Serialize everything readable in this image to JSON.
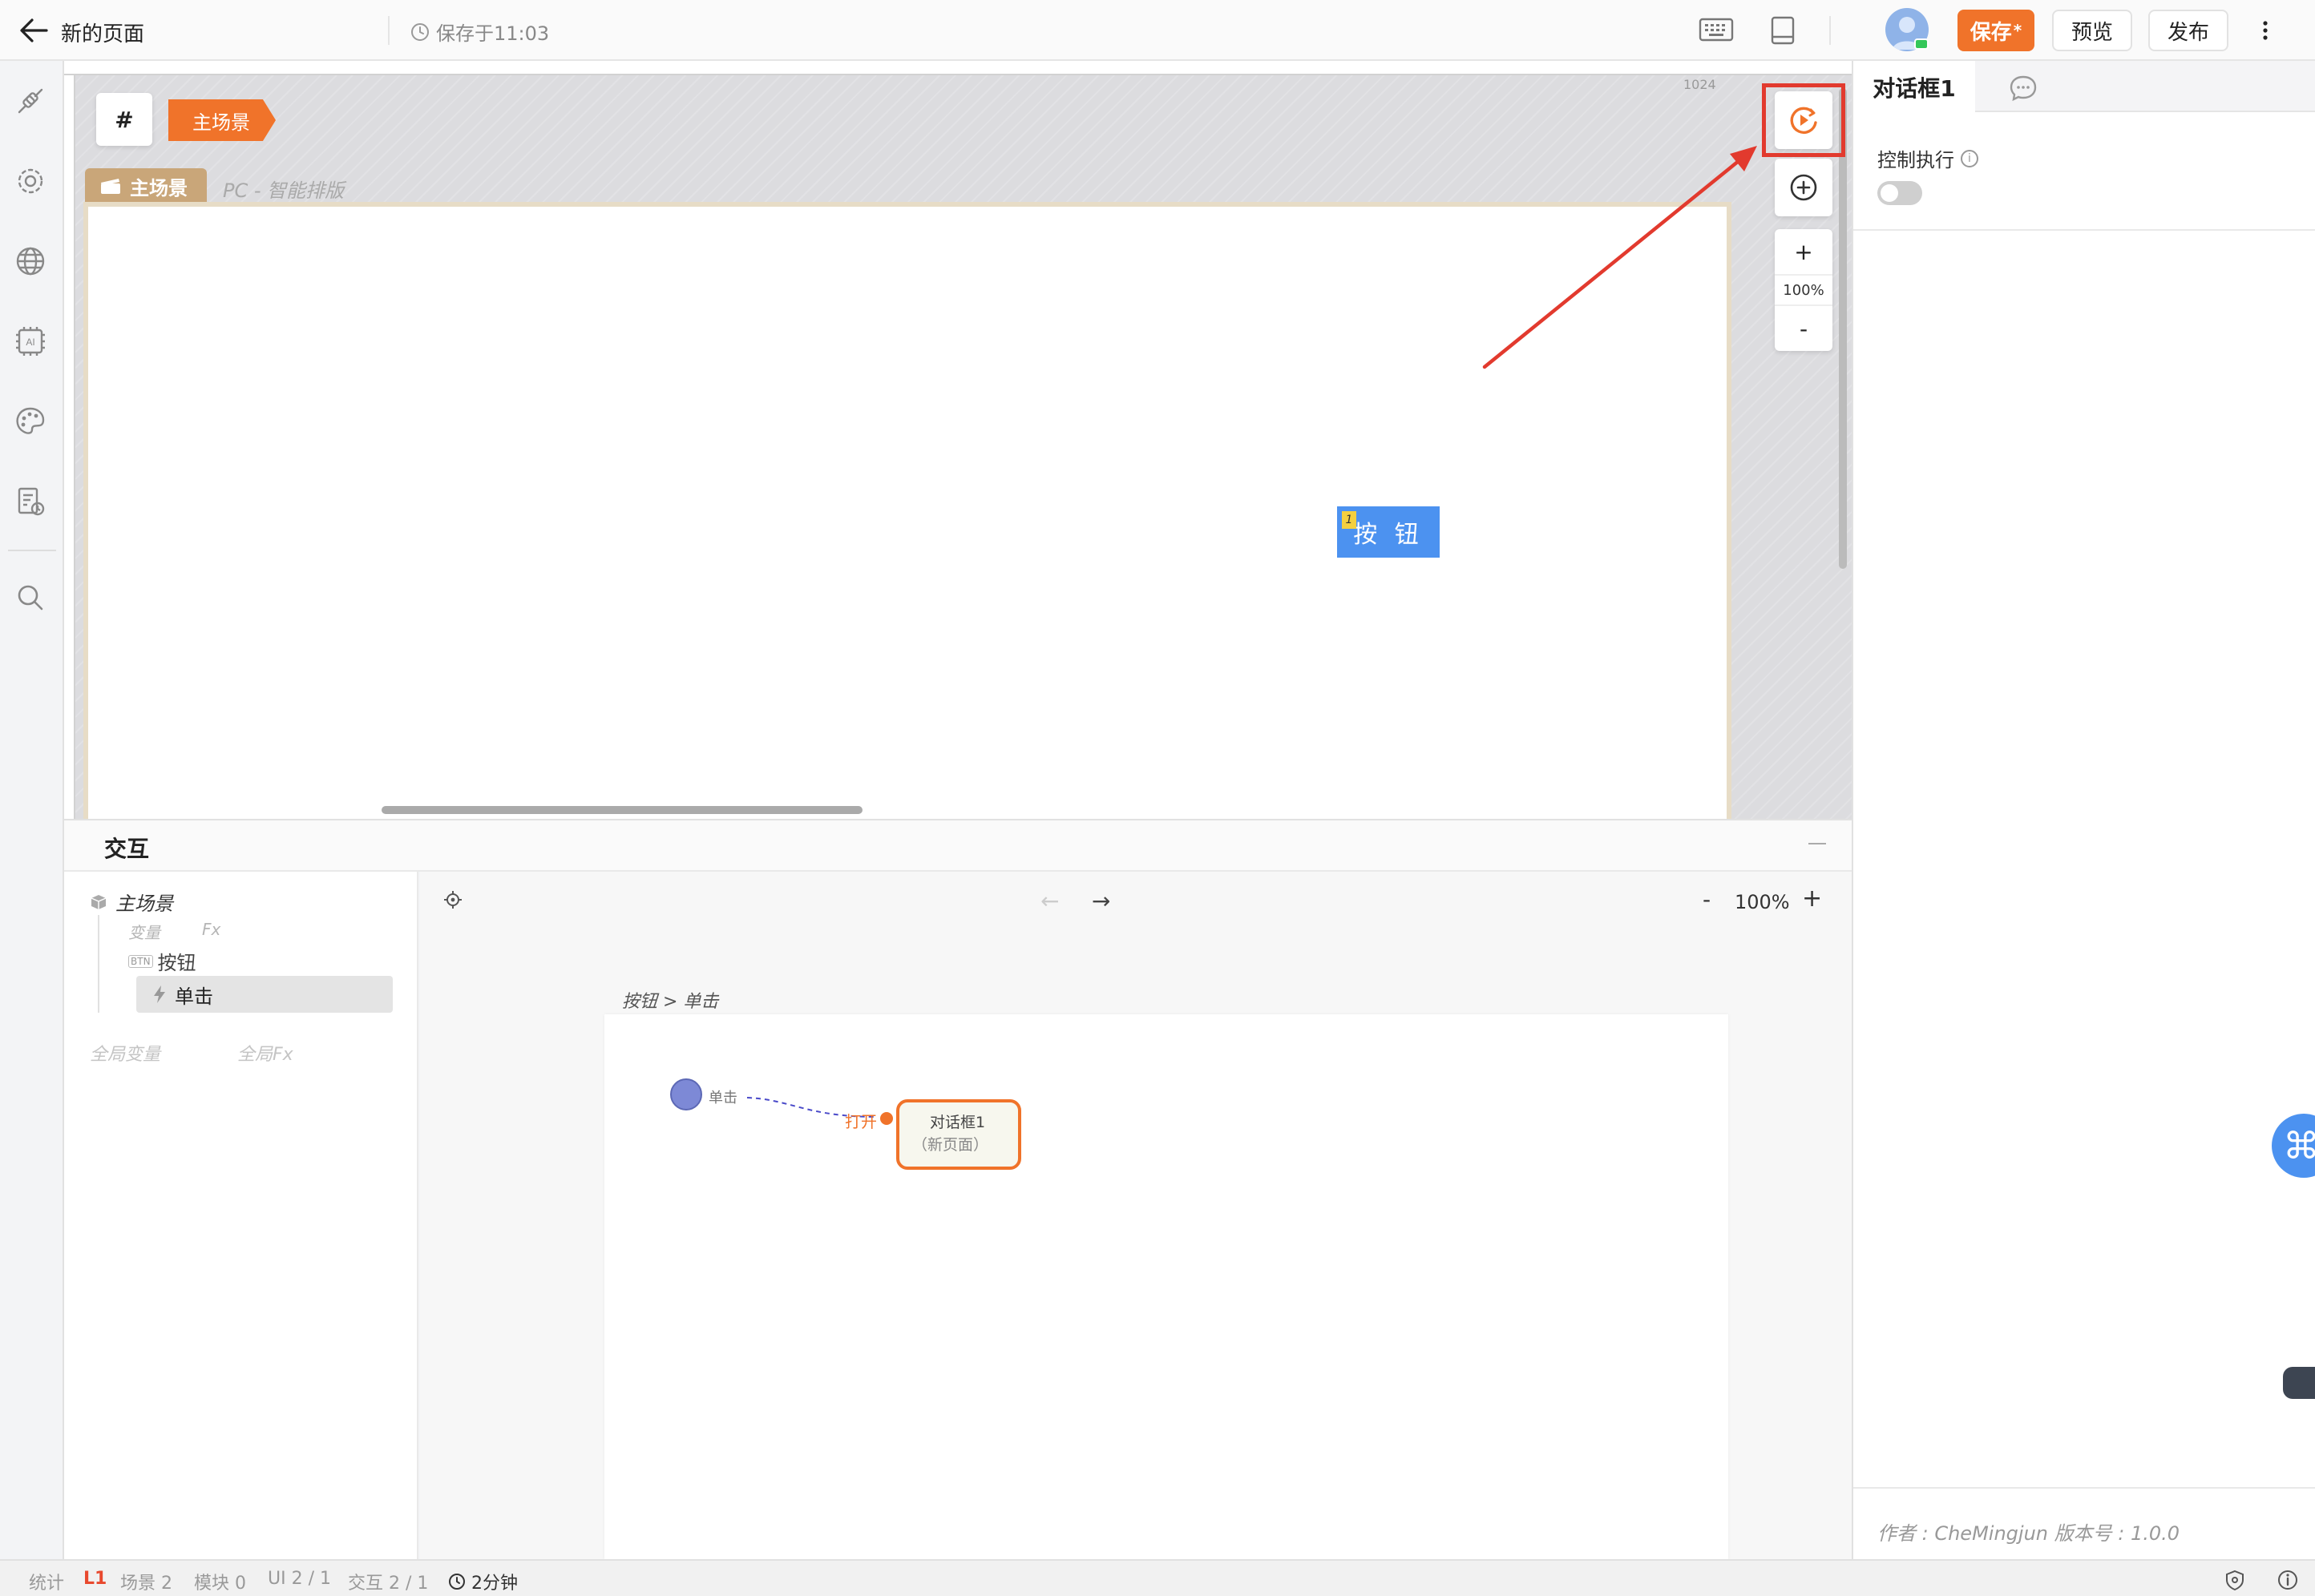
{
  "topbar": {
    "title": "新的页面",
    "save_status": "保存于11:03",
    "save_label": "保存",
    "save_mark": "*",
    "preview_label": "预览",
    "publish_label": "发布"
  },
  "canvas": {
    "hash_label": "#",
    "scene_tag": "主场景",
    "scene_label": "主场景",
    "scene_sub": "PC - 智能排版",
    "ruler_label": "1024",
    "button_label": "按 钮",
    "button_badge": "1",
    "zoom_plus": "+",
    "zoom_value": "100%",
    "zoom_minus": "-"
  },
  "right_panel": {
    "tab_active": "对话框1",
    "control_label": "控制执行",
    "info_mark": "i",
    "footer": "作者 : CheMingjun    版本号 : 1.0.0",
    "toggle_on": false
  },
  "interaction": {
    "title": "交互",
    "tree": {
      "root": "主场景",
      "var_label": "变量",
      "fx_label": "Fx",
      "button_tag": "BTN",
      "button_label": "按钮",
      "event_label": "单击",
      "global_var": "全局变量",
      "global_fx": "全局Fx"
    },
    "toolbar": {
      "back": "←",
      "forward": "→",
      "zoom_minus": "-",
      "zoom_value": "100%",
      "zoom_plus": "+"
    },
    "crumb": "按钮 > 单击",
    "flow": {
      "start_label": "单击",
      "open_label": "打开",
      "node_title": "对话框1",
      "node_sub": "（新页面）"
    }
  },
  "statusbar": {
    "stats": "统计",
    "level": "L1",
    "scenes": "场景  2",
    "modules": "模块  0",
    "ui": "UI  2 / 1",
    "interactions": "交互  2 / 1",
    "time": "2分钟"
  },
  "colors": {
    "accent": "#f0732a",
    "highlight": "#e23a2e",
    "button_blue": "#4c92f0",
    "scene_gold": "#c9a679"
  }
}
